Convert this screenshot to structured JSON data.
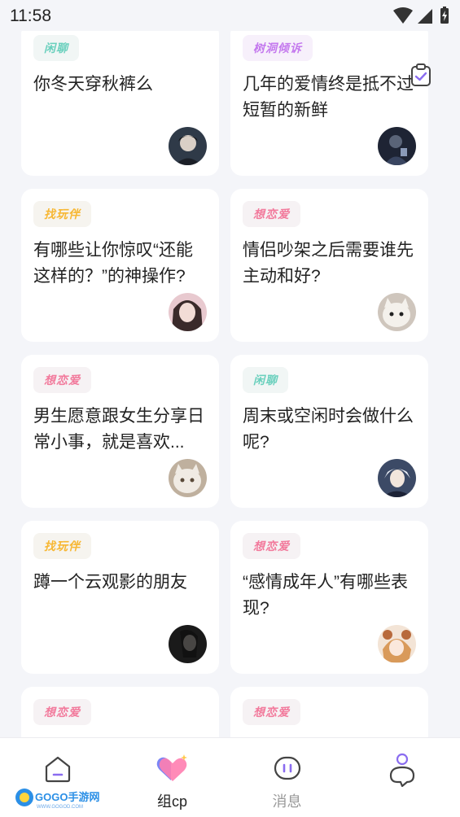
{
  "status_bar": {
    "time": "11:58"
  },
  "feed": {
    "cards": [
      {
        "tag": "闲聊",
        "tag_color": "teal",
        "title": "你冬天穿秋裤么",
        "avatar": "avatar-dark-hair-boy"
      },
      {
        "tag": "树洞倾诉",
        "tag_color": "purple",
        "title": "几年的爱情终是抵不过短暂的新鲜",
        "avatar": "avatar-dark-scene"
      },
      {
        "tag": "找玩伴",
        "tag_color": "orange",
        "title": "有哪些让你惊叹“还能这样的？”的神操作?",
        "avatar": "avatar-girl-pink"
      },
      {
        "tag": "想恋爱",
        "tag_color": "pink",
        "title": "情侣吵架之后需要谁先主动和好?",
        "avatar": "avatar-white-cat"
      },
      {
        "tag": "想恋爱",
        "tag_color": "pink",
        "title": "男生愿意跟女生分享日常小事，就是喜欢...",
        "avatar": "avatar-white-cat-2"
      },
      {
        "tag": "闲聊",
        "tag_color": "teal",
        "title": "周末或空闲时会做什么呢?",
        "avatar": "avatar-anime-boy"
      },
      {
        "tag": "找玩伴",
        "tag_color": "orange",
        "title": "蹲一个云观影的朋友",
        "avatar": "avatar-girl-dark"
      },
      {
        "tag": "想恋爱",
        "tag_color": "pink",
        "title": "“感情成年人”有哪些表现?",
        "avatar": "avatar-anime-girl"
      },
      {
        "tag": "想恋爱",
        "tag_color": "pink",
        "title": "",
        "avatar": ""
      },
      {
        "tag": "想恋爱",
        "tag_color": "pink",
        "title": "",
        "avatar": ""
      }
    ]
  },
  "floating": {
    "icon": "clipboard-check-icon"
  },
  "tabbar": {
    "home": {
      "icon": "home-icon",
      "label": ""
    },
    "cp": {
      "icon": "hearts-icon",
      "label": "组cp"
    },
    "messages": {
      "icon": "message-icon",
      "label": "消息"
    },
    "profile": {
      "icon": "profile-icon",
      "label": ""
    }
  },
  "watermark": {
    "text": "GOGO手游网",
    "subtext": "WWW.GOGOD.COM"
  }
}
